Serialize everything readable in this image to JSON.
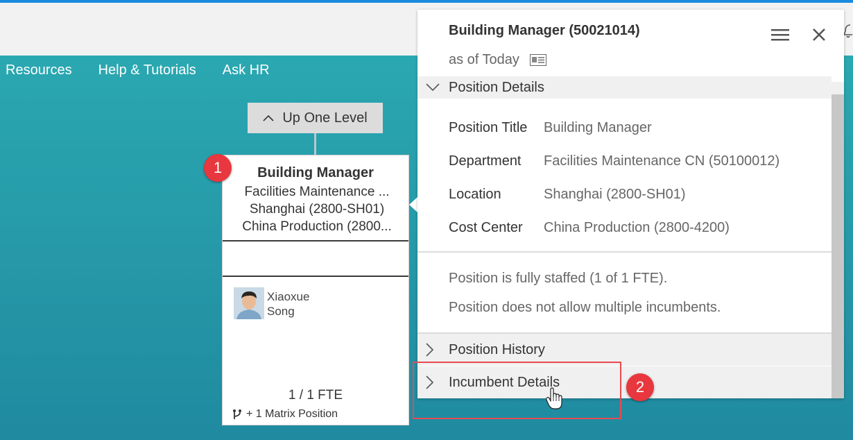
{
  "nav": {
    "items": [
      "Resources",
      "Help & Tutorials",
      "Ask HR"
    ]
  },
  "orgchart": {
    "up_level_label": "Up One Level",
    "card": {
      "title": "Building Manager",
      "department": "Facilities Maintenance ...",
      "location": "Shanghai (2800-SH01)",
      "cost_center": "China Production (2800...",
      "incumbent_first": "Xiaoxue",
      "incumbent_last": "Song",
      "fte": "1 / 1 FTE",
      "matrix": "+ 1 Matrix Position"
    }
  },
  "panel": {
    "title": "Building Manager (50021014)",
    "as_of": "as of Today",
    "sections": {
      "position_details": "Position Details",
      "position_history": "Position History",
      "incumbent_details": "Incumbent Details"
    },
    "details": [
      {
        "label": "Position Title",
        "value": "Building Manager"
      },
      {
        "label": "Department",
        "value": "Facilities Maintenance CN (50100012)"
      },
      {
        "label": "Location",
        "value": "Shanghai (2800-SH01)"
      },
      {
        "label": "Cost Center",
        "value": "China Production (2800-4200)"
      }
    ],
    "status": [
      "Position is fully staffed (1 of 1 FTE).",
      "Position does not allow multiple incumbents."
    ]
  },
  "annotations": {
    "badge1": "1",
    "badge2": "2"
  },
  "colors": {
    "accent": "#1b8be0",
    "teal": "#2aa1ad",
    "badge": "#e8373e"
  }
}
